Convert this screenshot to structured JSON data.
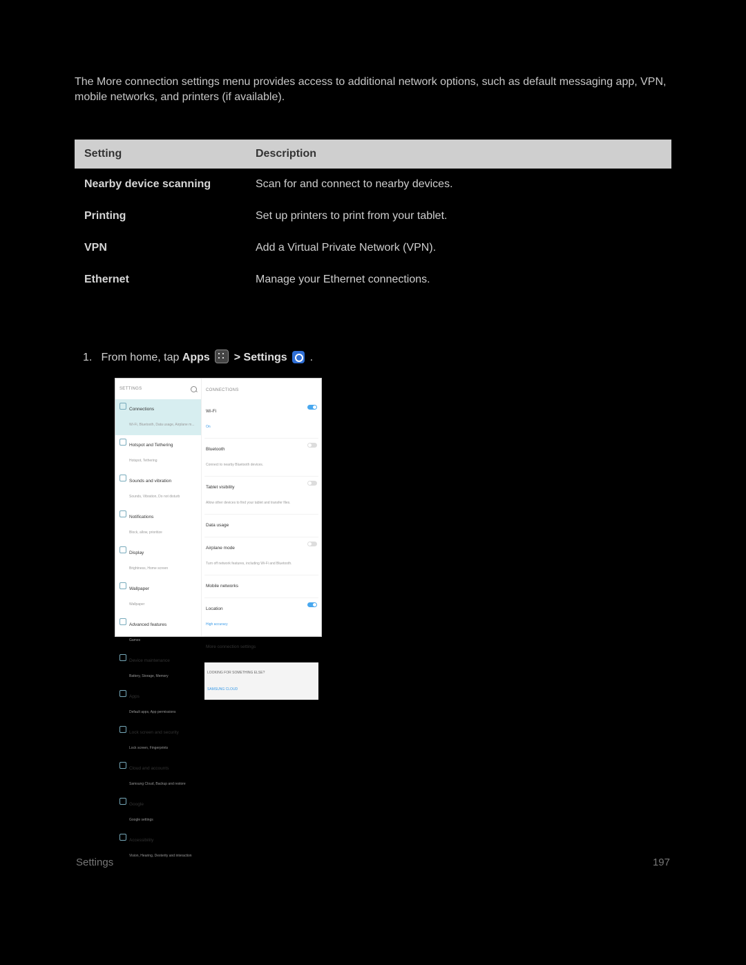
{
  "intro": "The More connection settings menu provides access to additional network options, such as default messaging app, VPN, mobile networks, and printers (if available).",
  "table": {
    "head": {
      "a": "Setting",
      "b": "Description"
    },
    "rows": [
      {
        "a": "Nearby device scanning",
        "b": "Scan for and connect to nearby devices."
      },
      {
        "a": "Printing",
        "b": "Set up printers to print from your tablet."
      },
      {
        "a": "VPN",
        "b": "Add a Virtual Private Network (VPN)."
      },
      {
        "a": "Ethernet",
        "b": "Manage your Ethernet connections."
      }
    ]
  },
  "step": {
    "num": "1.",
    "pre": "From home, tap ",
    "apps": "Apps",
    "sep": " > ",
    "settings": "Settings",
    "post": "."
  },
  "shot": {
    "left_header": "SETTINGS",
    "right_header": "CONNECTIONS",
    "sidebar": [
      {
        "t": "Connections",
        "s": "Wi-Fi, Bluetooth, Data usage, Airplane m...",
        "sel": true
      },
      {
        "t": "Hotspot and Tethering",
        "s": "Hotspot, Tethering"
      },
      {
        "t": "Sounds and vibration",
        "s": "Sounds, Vibration, Do not disturb"
      },
      {
        "t": "Notifications",
        "s": "Block, allow, prioritize"
      },
      {
        "t": "Display",
        "s": "Brightness, Home screen"
      },
      {
        "t": "Wallpaper",
        "s": "Wallpaper"
      },
      {
        "t": "Advanced features",
        "s": "Games"
      },
      {
        "t": "Device maintenance",
        "s": "Battery, Storage, Memory"
      },
      {
        "t": "Apps",
        "s": "Default apps, App permissions"
      },
      {
        "t": "Lock screen and security",
        "s": "Lock screen, Fingerprints"
      },
      {
        "t": "Cloud and accounts",
        "s": "Samsung Cloud, Backup and restore"
      },
      {
        "t": "Google",
        "s": "Google settings"
      },
      {
        "t": "Accessibility",
        "s": "Vision, Hearing, Dexterity and interaction"
      }
    ],
    "rows": [
      {
        "t": "Wi-Fi",
        "s": "",
        "acc": "On",
        "toggle": "on"
      },
      {
        "t": "Bluetooth",
        "s": "Connect to nearby Bluetooth devices.",
        "toggle": "off"
      },
      {
        "t": "Tablet visibility",
        "s": "Allow other devices to find your tablet and transfer files.",
        "toggle": "off"
      },
      {
        "t": "Data usage",
        "s": ""
      },
      {
        "t": "Airplane mode",
        "s": "Turn off network features, including Wi-Fi and Bluetooth.",
        "toggle": "off"
      },
      {
        "t": "Mobile networks",
        "s": ""
      },
      {
        "t": "Location",
        "s": "",
        "acc": "High accuracy",
        "toggle": "on"
      },
      {
        "t": "More connection settings",
        "s": ""
      }
    ],
    "look": {
      "t": "LOOKING FOR SOMETHING ELSE?",
      "l": "SAMSUNG CLOUD"
    }
  },
  "footer": {
    "left": "Settings",
    "right": "197"
  }
}
